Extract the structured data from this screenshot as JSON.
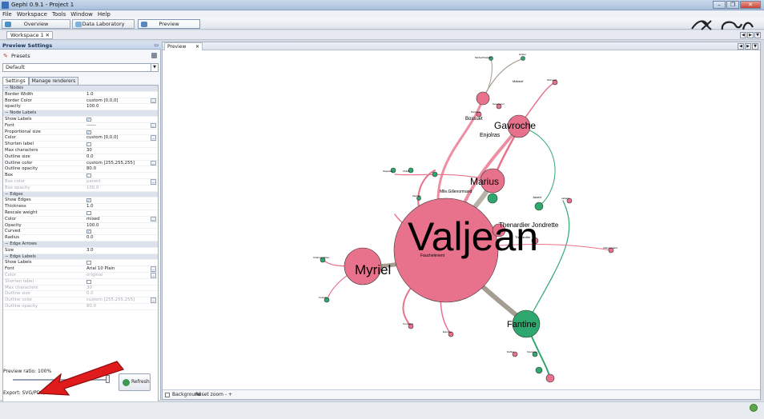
{
  "window": {
    "title": "Gephi 0.9.1 - Project 1",
    "buttons": [
      "–",
      "❐",
      "✕"
    ]
  },
  "menu": [
    "File",
    "Workspace",
    "Tools",
    "Window",
    "Help"
  ],
  "modes": [
    {
      "label": "Overview",
      "icon": "overview-icon",
      "color": "#4a90c8"
    },
    {
      "label": "Data Laboratory",
      "icon": "data-lab-icon",
      "color": "#7fb3dc"
    },
    {
      "label": "Preview",
      "icon": "preview-icon",
      "color": "#5b86c0"
    }
  ],
  "workspace_tab": "Workspace 1",
  "preview_settings": {
    "panel_title": "Preview Settings",
    "presets_label": "Presets",
    "preset_value": "Default",
    "tabs": [
      "Settings",
      "Manage renderers"
    ],
    "rows": [
      {
        "cat": "Nodes"
      },
      {
        "k": "Border Width",
        "v": "1.0"
      },
      {
        "k": "Border Color",
        "v": "custom [0,0,0]",
        "ed": true
      },
      {
        "k": "opacity",
        "v": "100.0"
      },
      {
        "cat": "Node Labels"
      },
      {
        "k": "Show Labels",
        "check": true
      },
      {
        "k": "Font",
        "v": "------",
        "ed": true
      },
      {
        "k": "Proportional size",
        "check": true
      },
      {
        "k": "Color",
        "v": "custom [0,0,0]",
        "ed": true
      },
      {
        "k": "Shorten label",
        "check": false
      },
      {
        "k": "Max characters",
        "v": "30"
      },
      {
        "k": "Outline size",
        "v": "0.0"
      },
      {
        "k": "Outline color",
        "v": "custom [255,255,255]",
        "ed": true
      },
      {
        "k": "Outline opacity",
        "v": "80.0"
      },
      {
        "k": "Box",
        "check": false
      },
      {
        "k": "Box color",
        "v": "parent",
        "ed": true,
        "dim": true
      },
      {
        "k": "Box opacity",
        "v": "100.0",
        "dim": true
      },
      {
        "cat": "Edges"
      },
      {
        "k": "Show Edges",
        "check": true
      },
      {
        "k": "Thickness",
        "v": "1.0"
      },
      {
        "k": "Rescale weight",
        "check": false
      },
      {
        "k": "Color",
        "v": "mixed",
        "ed": true
      },
      {
        "k": "Opacity",
        "v": "100.0"
      },
      {
        "k": "Curved",
        "check": true
      },
      {
        "k": "Radius",
        "v": "0.0"
      },
      {
        "cat": "Edge Arrows"
      },
      {
        "k": "Size",
        "v": "3.0"
      },
      {
        "cat": "Edge Labels"
      },
      {
        "k": "Show Labels",
        "check": false
      },
      {
        "k": "Font",
        "v": "Arial 10 Plain",
        "ed": true
      },
      {
        "k": "Color",
        "v": "original",
        "ed": true,
        "dim": true
      },
      {
        "k": "Shorten label",
        "check": false,
        "dim": true
      },
      {
        "k": "Max characters",
        "v": "30",
        "dim": true
      },
      {
        "k": "Outline size",
        "v": "0.0",
        "dim": true
      },
      {
        "k": "Outline color",
        "v": "custom [255,255,255]",
        "ed": true,
        "dim": true
      },
      {
        "k": "Outline opacity",
        "v": "80.0",
        "dim": true
      }
    ],
    "ratio_label": "Preview ratio: 100%",
    "refresh_label": "Refresh",
    "export_label": "Export:  SVG/PDF/PNG"
  },
  "preview": {
    "tab_label": "Preview",
    "background_label": "Background",
    "reset_zoom_label": "Reset zoom",
    "zoom_controls": "-  +",
    "node_labels": [
      "Valjean",
      "Myriel",
      "Marius",
      "Gavroche",
      "Fantine",
      "Thenardier Jondrette",
      "Bossuet",
      "Enjolras",
      "Mlle.Gillenormand",
      "Fauchelevent",
      "Mabeuf",
      "Javert",
      "Thenardier",
      "MotherPlutarch",
      "Gribier",
      "Napoleon",
      "Child1",
      "Champmathieu",
      "Cosette",
      "Gillenormand",
      "Labarre",
      "Woman2",
      "Toussaint",
      "Eponine",
      "Favourite",
      "Dahlia",
      "Zephine",
      "Perpetue",
      "Gueulemer"
    ]
  },
  "colors": {
    "pink": "#e8728c",
    "green": "#2fa86f",
    "edge_gray": "#a59d92",
    "arrow_red": "#e01b1b"
  }
}
